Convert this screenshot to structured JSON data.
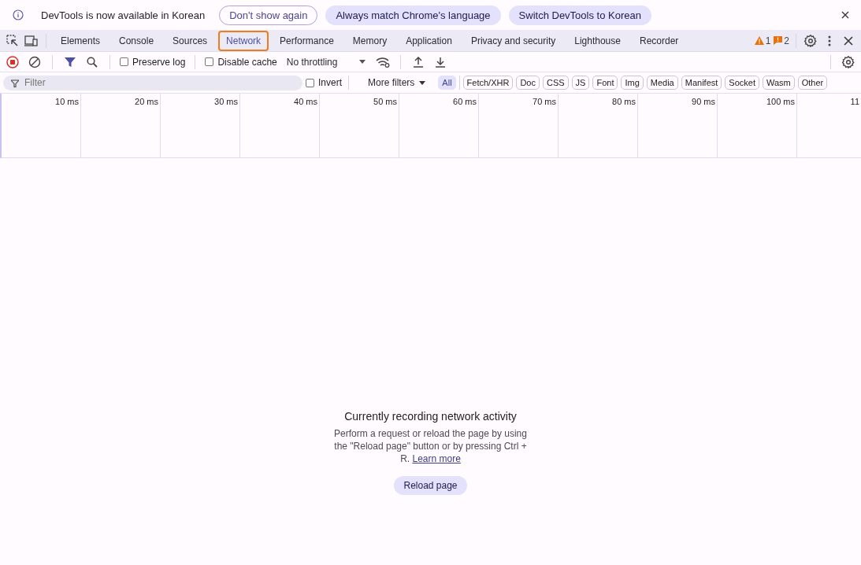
{
  "infobar": {
    "message": "DevTools is now available in Korean",
    "buttons": [
      {
        "label": "Don't show again",
        "kind": "outline"
      },
      {
        "label": "Always match Chrome's language",
        "kind": "filled"
      },
      {
        "label": "Switch DevTools to Korean",
        "kind": "filled"
      }
    ]
  },
  "tabs": [
    {
      "label": "Elements",
      "selected": false,
      "highlighted": false
    },
    {
      "label": "Console",
      "selected": false,
      "highlighted": false
    },
    {
      "label": "Sources",
      "selected": false,
      "highlighted": false
    },
    {
      "label": "Network",
      "selected": true,
      "highlighted": true
    },
    {
      "label": "Performance",
      "selected": false,
      "highlighted": false
    },
    {
      "label": "Memory",
      "selected": false,
      "highlighted": false
    },
    {
      "label": "Application",
      "selected": false,
      "highlighted": false
    },
    {
      "label": "Privacy and security",
      "selected": false,
      "highlighted": false
    },
    {
      "label": "Lighthouse",
      "selected": false,
      "highlighted": false
    },
    {
      "label": "Recorder",
      "selected": false,
      "highlighted": false
    }
  ],
  "counters": {
    "warnings": "1",
    "issues": "2"
  },
  "toolbar": {
    "recording": true,
    "preserve_log": {
      "label": "Preserve log",
      "checked": false
    },
    "disable_cache": {
      "label": "Disable cache",
      "checked": false
    },
    "throttling": "No throttling"
  },
  "filter_bar": {
    "placeholder": "Filter",
    "invert": {
      "label": "Invert",
      "checked": false
    },
    "more_filters": "More filters",
    "types": [
      {
        "label": "All",
        "selected": true
      },
      {
        "label": "Fetch/XHR",
        "selected": false
      },
      {
        "label": "Doc",
        "selected": false
      },
      {
        "label": "CSS",
        "selected": false
      },
      {
        "label": "JS",
        "selected": false
      },
      {
        "label": "Font",
        "selected": false
      },
      {
        "label": "Img",
        "selected": false
      },
      {
        "label": "Media",
        "selected": false
      },
      {
        "label": "Manifest",
        "selected": false
      },
      {
        "label": "Socket",
        "selected": false
      },
      {
        "label": "Wasm",
        "selected": false
      },
      {
        "label": "Other",
        "selected": false
      }
    ]
  },
  "timeline": {
    "ticks": [
      "10 ms",
      "20 ms",
      "30 ms",
      "40 ms",
      "50 ms",
      "60 ms",
      "70 ms",
      "80 ms",
      "90 ms",
      "100 ms",
      "11"
    ]
  },
  "empty_state": {
    "title": "Currently recording network activity",
    "text": "Perform a request or reload the page by using the \"Reload page\" button or by pressing Ctrl + R.",
    "link": "Learn more",
    "button": "Reload page"
  }
}
